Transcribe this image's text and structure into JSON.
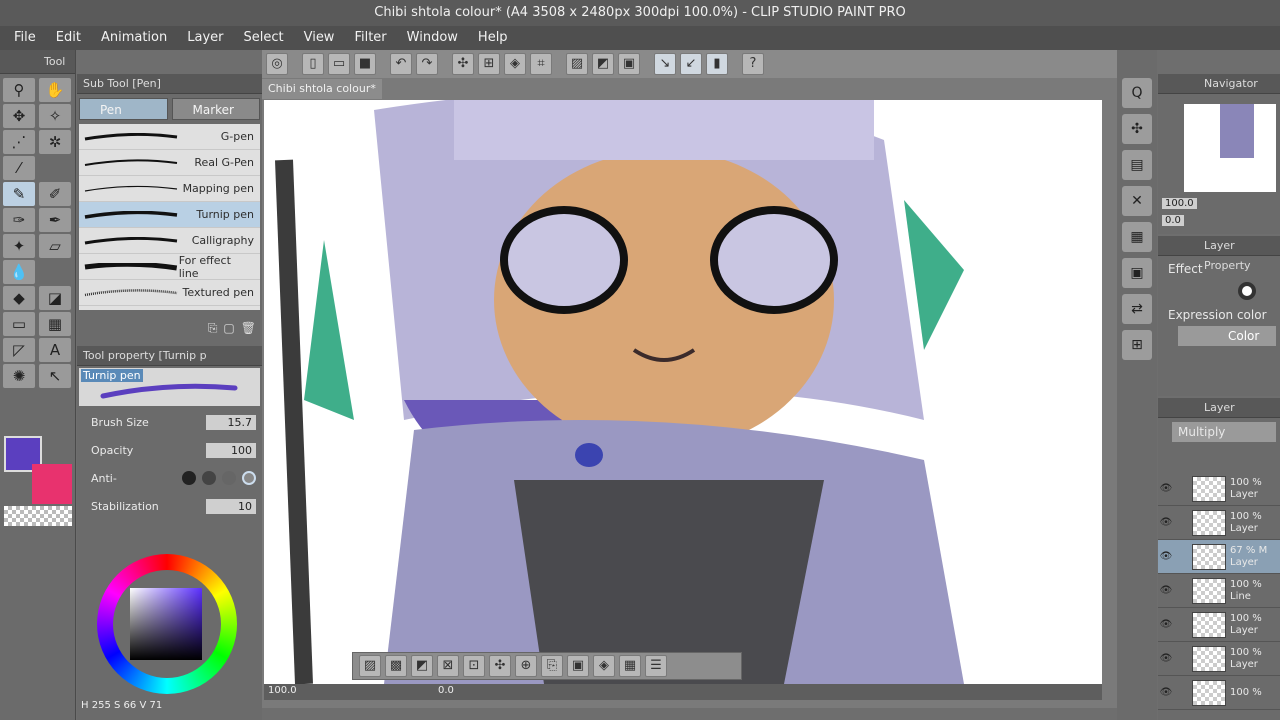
{
  "app": {
    "title": "Chibi shtola colour* (A4 3508 x 2480px 300dpi 100.0%) - CLIP STUDIO PAINT PRO"
  },
  "menu": [
    "File",
    "Edit",
    "Animation",
    "Layer",
    "Select",
    "View",
    "Filter",
    "Window",
    "Help"
  ],
  "tool_panel": {
    "title": "Tool"
  },
  "sub_tool": {
    "title": "Sub Tool [Pen]",
    "tabs": [
      "Pen",
      "Marker"
    ],
    "brushes": [
      "G-pen",
      "Real G-Pen",
      "Mapping pen",
      "Turnip pen",
      "Calligraphy",
      "For effect line",
      "Textured pen"
    ],
    "selected_brush": "Turnip pen"
  },
  "tool_property": {
    "title": "Tool property [Turnip p",
    "preview_label": "Turnip pen",
    "brush_size_label": "Brush Size",
    "brush_size_value": "15.7",
    "opacity_label": "Opacity",
    "opacity_value": "100",
    "anti_label": "Anti-",
    "stabilization_label": "Stabilization",
    "stabilization_value": "10"
  },
  "colors": {
    "main": "#5b3fbf",
    "sub": "#e8326e",
    "hair": "#b8b4d8",
    "hair_shadow": "#6a58b8",
    "skin": "#d9a676",
    "leaf": "#3fae8a",
    "accent_select": "#b9d0e4"
  },
  "color_wheel": {
    "h_label": "H",
    "h": "255",
    "s_label": "S",
    "s": "66",
    "v_label": "V",
    "v": "71"
  },
  "document_tab": "Chibi shtola colour*",
  "canvas_status": {
    "zoom": "100.0",
    "angle": "0.0"
  },
  "navigator": {
    "title": "Navigator",
    "zoom": "100.0",
    "angle": "0.0"
  },
  "layer_property": {
    "title": "Layer Property",
    "effect_label": "Effect",
    "expression_label": "Expression color",
    "expression_value": "Color"
  },
  "layer_panel": {
    "title": "Layer",
    "blend_mode": "Multiply",
    "layers": [
      {
        "opacity": "100 %",
        "name": "Layer"
      },
      {
        "opacity": "100 %",
        "name": "Layer"
      },
      {
        "opacity": "67 % M",
        "name": "Layer"
      },
      {
        "opacity": "100 %",
        "name": "Line"
      },
      {
        "opacity": "100 %",
        "name": "Layer"
      },
      {
        "opacity": "100 %",
        "name": "Layer"
      },
      {
        "opacity": "100 %",
        "name": ""
      }
    ]
  }
}
